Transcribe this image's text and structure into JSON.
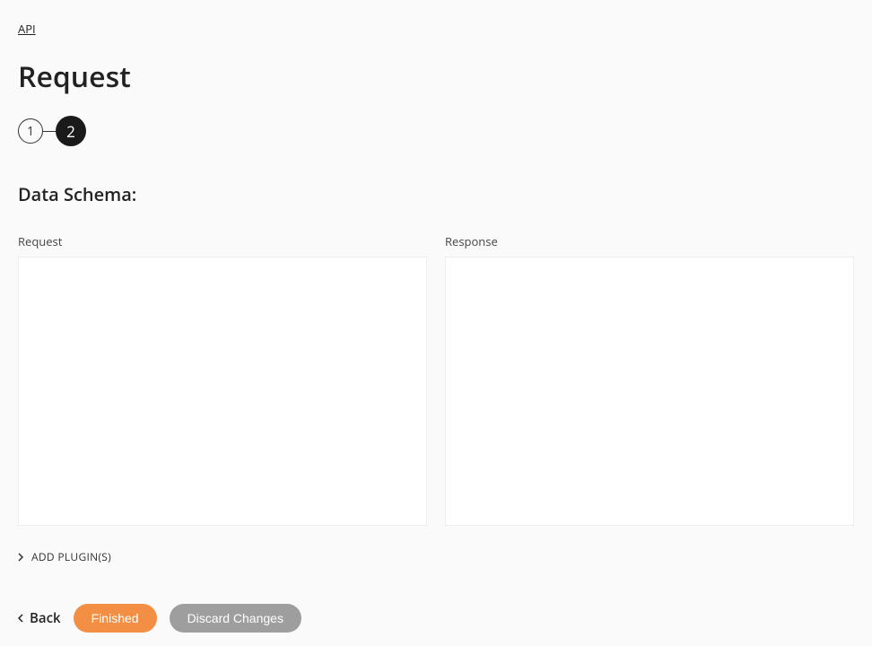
{
  "breadcrumb": {
    "label": "API"
  },
  "page_title": "Request",
  "stepper": {
    "steps": [
      {
        "label": "1",
        "active": false
      },
      {
        "label": "2",
        "active": true
      }
    ]
  },
  "section_title": "Data Schema:",
  "schema": {
    "request_label": "Request",
    "response_label": "Response",
    "request_value": "",
    "response_value": ""
  },
  "add_plugins_label": "ADD PLUGIN(S)",
  "actions": {
    "back_label": "Back",
    "finished_label": "Finished",
    "discard_label": "Discard Changes"
  }
}
